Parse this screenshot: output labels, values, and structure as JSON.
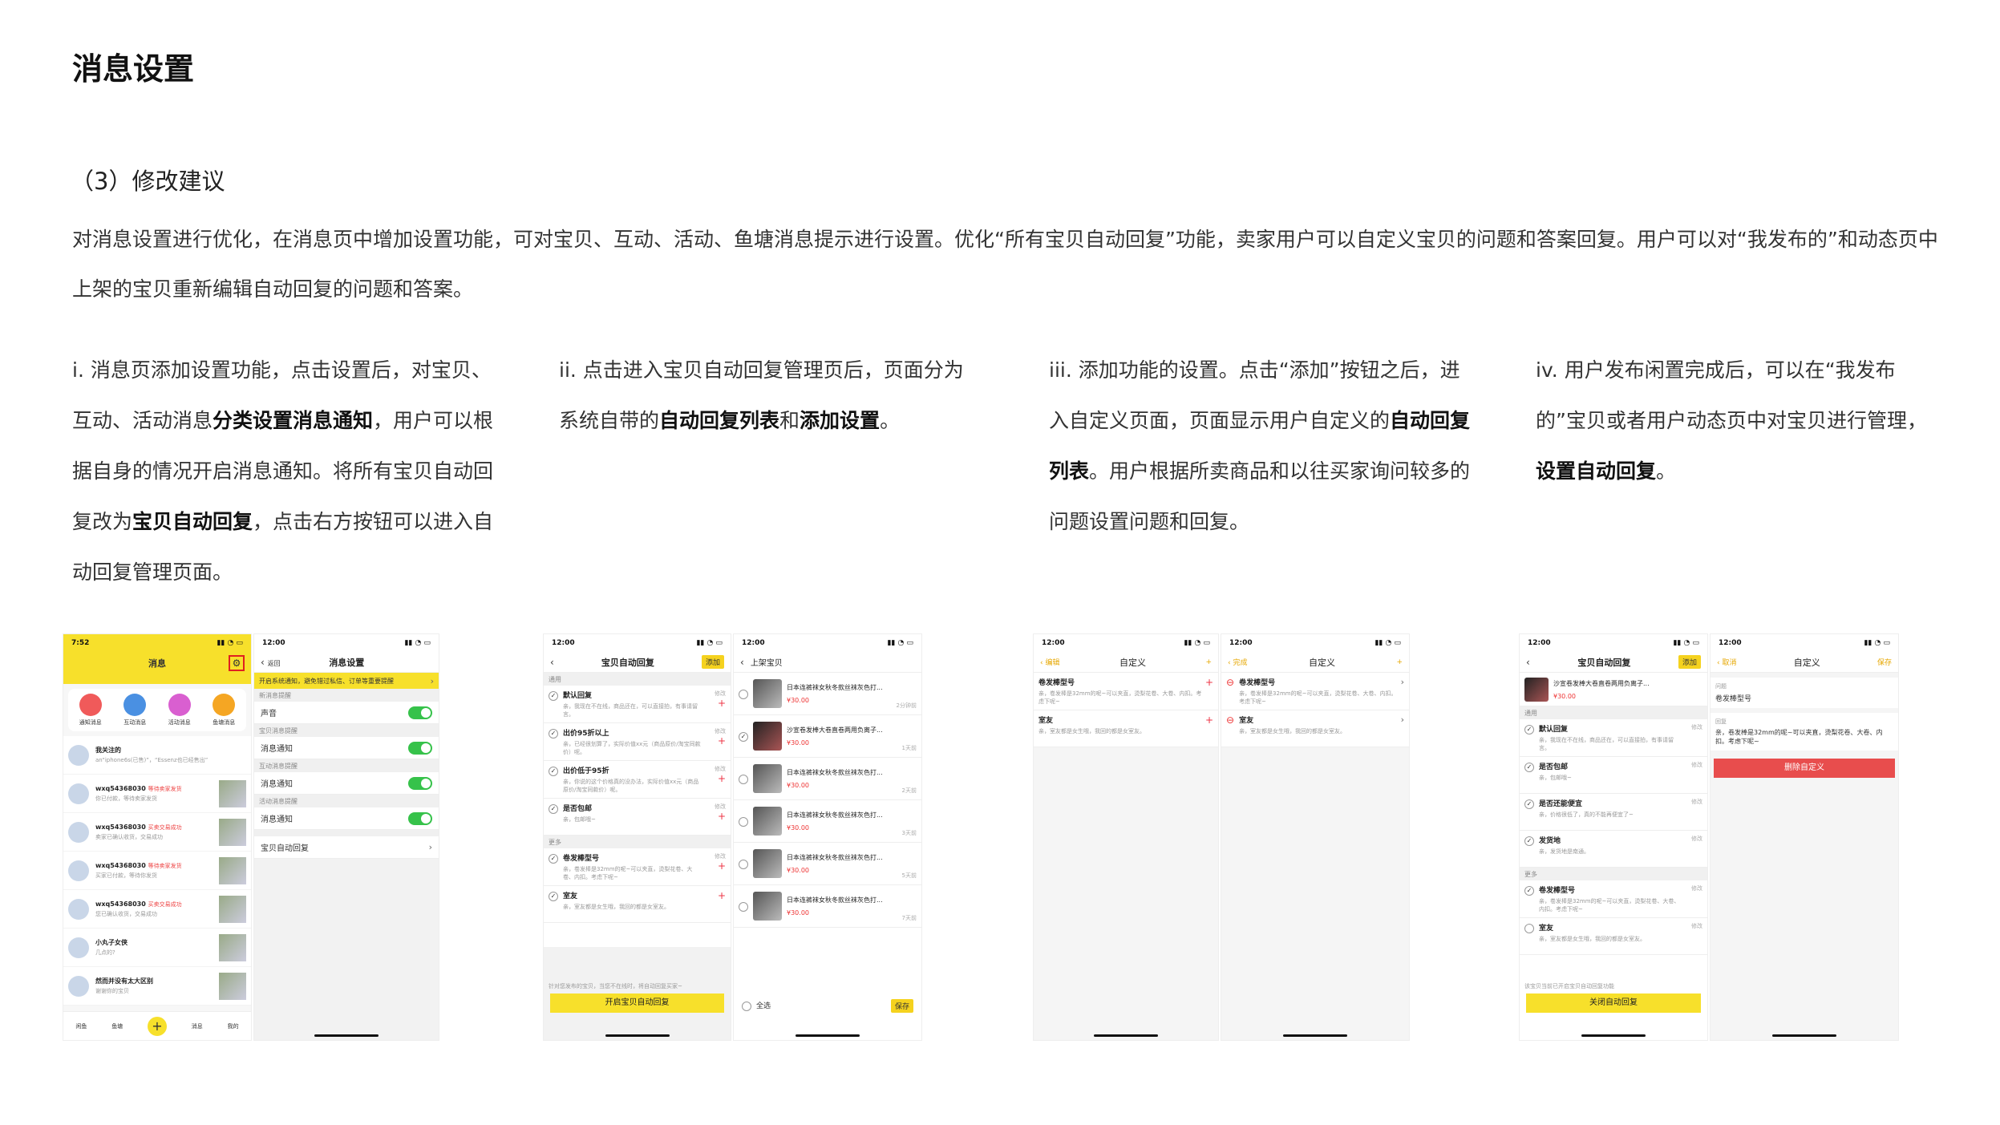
{
  "page_title": "消息设置",
  "section_title": "（3）修改建议",
  "intro": "对消息设置进行优化，在消息页中增加设置功能，可对宝贝、互动、活动、鱼塘消息提示进行设置。优化“所有宝贝自动回复”功能，卖家用户可以自定义宝贝的问题和答案回复。用户可以对“我发布的”和动态页中上架的宝贝重新编辑自动回复的问题和答案。",
  "columns": [
    {
      "p1": "i. 消息页添加设置功能，点击设置后，对宝贝、互动、活动消息",
      "b1": "分类设置消息通知",
      "p2": "，用户可以根据自身的情况开启消息通知。将所有宝贝自动回复改为",
      "b2": "宝贝自动回复",
      "p3": "，点击右方按钮可以进入自动回复管理页面。"
    },
    {
      "p1": "ii. 点击进入宝贝自动回复管理页后，页面分为系统自带的",
      "b1": "自动回复列表",
      "p2": "和",
      "b2": "添加设置",
      "p3": "。"
    },
    {
      "p1": "iii. 添加功能的设置。点击“添加”按钮之后，进入自定义页面，页面显示用户自定义的",
      "b1": "自动回复列表",
      "p2": "。用户根据所卖商品和以往买家询问较多的问题设置问题和回复。",
      "b2": "",
      "p3": ""
    },
    {
      "p1": "iv. 用户发布闲置完成后，可以在“我发布的”宝贝或者用户动态页中对宝贝进行管理，",
      "b1": "设置自动回复",
      "p2": "。",
      "b2": "",
      "p3": ""
    }
  ],
  "screens": {
    "msg": {
      "time": "7:52",
      "title": "消息",
      "icons": [
        "通知消息",
        "互动消息",
        "活动消息",
        "鱼塘消息"
      ],
      "rows": [
        {
          "name": "我关注的",
          "tag": "",
          "sub": "an“iphone6s(已售)”，“Essenz也已经售出”"
        },
        {
          "name": "wxq54368030",
          "tag": "等待卖家发货",
          "sub": "你已付款，等待卖家发货"
        },
        {
          "name": "wxq54368030",
          "tag": "买卖交易成功",
          "sub": "卖家已确认收货，交易成功"
        },
        {
          "name": "wxq54368030",
          "tag": "等待卖家发货",
          "sub": "买家已付款，等待你发货"
        },
        {
          "name": "wxq54368030",
          "tag": "买卖交易成功",
          "sub": "您已确认收货，交易成功"
        },
        {
          "name": "小丸子女侠",
          "tag": "",
          "sub": "几点的?"
        },
        {
          "name": "然而并没有太大区别",
          "tag": "",
          "sub": "谢谢你的宝贝"
        }
      ],
      "tabs": [
        "闲鱼",
        "鱼塘",
        "发布",
        "消息",
        "我的"
      ]
    },
    "settings": {
      "time": "12:00",
      "back": "返回",
      "title": "消息设置",
      "banner": "开启系统通知，避免错过私信、订单等重要提醒",
      "groups": [
        {
          "group": "新消息提醒",
          "label": "声音"
        },
        {
          "group": "宝贝消息提醒",
          "label": "消息通知"
        },
        {
          "group": "互动消息提醒",
          "label": "消息通知"
        },
        {
          "group": "活动消息提醒",
          "label": "消息通知"
        }
      ],
      "auto_reply": "宝贝自动回复"
    },
    "auto": {
      "time": "12:00",
      "title": "宝贝自动回复",
      "add": "添加",
      "common": "通用",
      "more": "更多",
      "edit": "修改",
      "items": [
        {
          "q": "默认回复",
          "a": "亲，我现在不在线，商品还在，可以直接拍，有事请留言。"
        },
        {
          "q": "出价95折以上",
          "a": "亲，已经很划算了，实际价值xx元（商品原价/淘宝同款价）呢。"
        },
        {
          "q": "出价低于95折",
          "a": "亲，你说的这个价格真的没办法，实际价值xx元（商品原价/淘宝同款价）呢。"
        },
        {
          "q": "是否包邮",
          "a": "亲，包邮哦~"
        }
      ],
      "more_items": [
        {
          "q": "卷发棒型号",
          "a": "亲，卷发棒是32mm的呢~可以夹直，烫梨花卷、大卷、内扣。考虑下呢~"
        },
        {
          "q": "室友",
          "a": "亲，室友都是女生哦，我回的都是女室友。"
        }
      ],
      "hint": "针对您发布的宝贝，当您不在线时，将自动回复买家~",
      "button": "开启宝贝自动回复"
    },
    "goods": {
      "time": "12:00",
      "title": "上架宝贝",
      "items": [
        {
          "t": "日本连裤袜女秋冬款丝袜灰色打...",
          "p": "¥30.00",
          "time": "2分钟前"
        },
        {
          "t": "沙宣卷发棒大卷直卷两用负离子...",
          "p": "¥30.00",
          "time": "1天前"
        },
        {
          "t": "日本连裤袜女秋冬款丝袜灰色打...",
          "p": "¥30.00",
          "time": "2天前"
        },
        {
          "t": "日本连裤袜女秋冬款丝袜灰色打...",
          "p": "¥30.00",
          "time": "3天前"
        },
        {
          "t": "日本连裤袜女秋冬款丝袜灰色打...",
          "p": "¥30.00",
          "time": "5天前"
        },
        {
          "t": "日本连裤袜女秋冬款丝袜灰色打...",
          "p": "¥30.00",
          "time": "7天前"
        }
      ],
      "select_all": "全选",
      "save": "保存"
    },
    "custom1": {
      "time": "12:00",
      "left": "编辑",
      "title": "自定义",
      "items": [
        {
          "q": "卷发棒型号",
          "a": "亲，卷发棒是32mm的呢~可以夹直，烫梨花卷、大卷、内扣。考虑下呢~"
        },
        {
          "q": "室友",
          "a": "亲，室友都是女生哦，我回的都是女室友。"
        }
      ]
    },
    "custom2": {
      "time": "12:00",
      "left": "完成",
      "title": "自定义"
    },
    "item_auto": {
      "time": "12:00",
      "title": "宝贝自动回复",
      "add": "添加",
      "goods_title": "沙宣卷发棒大卷直卷两用负离子...",
      "goods_price": "¥30.00",
      "common": "通用",
      "more": "更多",
      "edit": "修改",
      "items": [
        {
          "q": "默认回复",
          "a": "亲，我现在不在线，商品还在，可以直接拍，有事请留言。"
        },
        {
          "q": "是否包邮",
          "a": "亲，包邮哦~"
        },
        {
          "q": "是否还能便宜",
          "a": "亲，价格很低了，真的不能再便宜了~"
        },
        {
          "q": "发货地",
          "a": "亲，发货地是南通。"
        }
      ],
      "more_items": [
        {
          "q": "卷发棒型号",
          "a": "亲，卷发棒是32mm的呢~可以夹直，烫梨花卷、大卷、内扣。考虑下呢~"
        },
        {
          "q": "室友",
          "a": "亲，室友都是女生哦，我回的都是女室友。"
        }
      ],
      "hint": "该宝贝当前已开启宝贝自动回复功能",
      "button": "关闭自动回复"
    },
    "edit_custom": {
      "time": "12:00",
      "cancel": "取消",
      "title": "自定义",
      "save": "保存",
      "q_label": "问题",
      "q": "卷发棒型号",
      "a_label": "回复",
      "a": "亲，卷发棒是32mm的呢~可以夹直，烫梨花卷、大卷、内扣。考虑下呢~",
      "delete": "删除自定义"
    }
  },
  "colors": {
    "accent_yellow": "#f7e02b",
    "toggle_green": "#36c24a",
    "danger_red": "#e84d4d"
  }
}
